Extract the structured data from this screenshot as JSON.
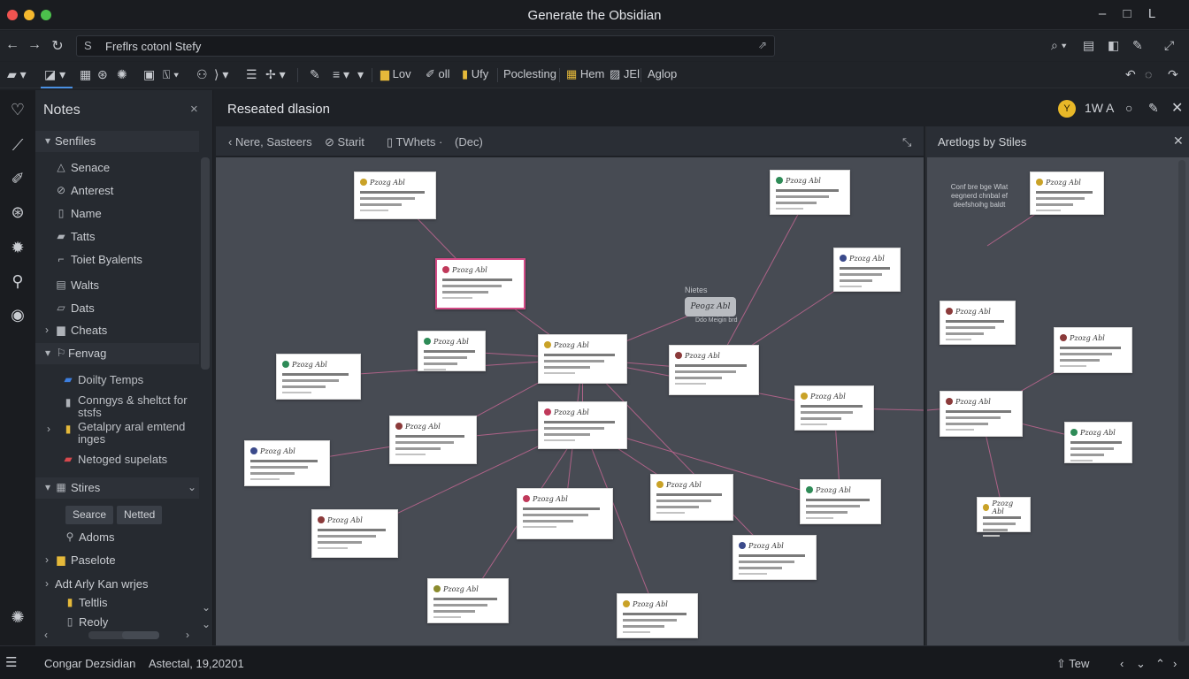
{
  "window": {
    "title": "Generate the Obsidian",
    "controls": [
      "–",
      "L"
    ]
  },
  "address": {
    "prefix": "S",
    "url": "Freflrs cotonl Stefy",
    "go": "⇗"
  },
  "toolbar": {
    "items": [
      "Lov",
      "oll",
      "Ufy",
      "Poclesting",
      "Hem",
      "JEl",
      "Aglop"
    ]
  },
  "sidebar": {
    "title": "Notes",
    "close": "×",
    "items": [
      {
        "label": "Senfiles",
        "type": "section"
      },
      {
        "label": "Senace"
      },
      {
        "label": "Anterest"
      },
      {
        "label": "Name"
      },
      {
        "label": "Tatts"
      },
      {
        "label": "Toiet Byalents"
      },
      {
        "label": "Walts"
      },
      {
        "label": "Dats"
      },
      {
        "label": "Cheats"
      },
      {
        "label": "Fenvag",
        "type": "section"
      },
      {
        "label": "Doilty Temps"
      },
      {
        "label": "Conngys & sheltct for stsfs"
      },
      {
        "label": "Getalpry aral emtend inges"
      },
      {
        "label": "Netoged supelats"
      },
      {
        "label": "Stires",
        "type": "section"
      },
      {
        "label": "Adoms"
      },
      {
        "label": "Paselote"
      },
      {
        "label": "Adt Arly Kan wrjes"
      },
      {
        "label": "Teltlis"
      },
      {
        "label": "Reoly"
      }
    ],
    "chips": [
      "Searce",
      "Netted"
    ]
  },
  "main": {
    "title": "Reseated dlasion",
    "header_icons": [
      "1W",
      "A"
    ],
    "badge": "Y",
    "breadcrumb": [
      "Nere, Sasteers",
      "Starit",
      "TWhets",
      "(Dec)"
    ]
  },
  "graph": {
    "node_title": "Pzozg Abl",
    "label_notes": "Nietes",
    "pill": "Peogz Abl",
    "sub_pill": "Ddo Meigin brd"
  },
  "right_panel": {
    "title": "Aretlogs by Stiles",
    "note": "Conf bre bge Wlat eegnerd chnbal ef deefshoihg baldt"
  },
  "status": {
    "app": "Congar Dezsidian",
    "date": "Astectal, 19,20201",
    "right": "Tew"
  },
  "colors": {
    "accent": "#4a90e2",
    "highlight": "#d34a86",
    "edge": "#c06690",
    "badge": "#e8b828"
  }
}
